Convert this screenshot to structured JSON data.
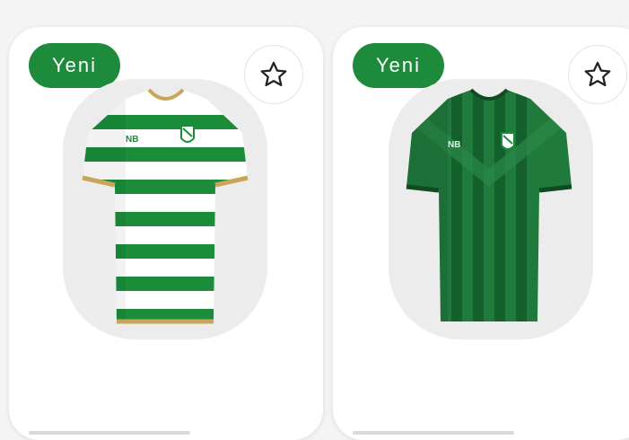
{
  "products": [
    {
      "badge_label": "Yeni",
      "favorite_icon": "star-outline-icon",
      "image": "white-green-striped-jersey",
      "colors": {
        "primary": "#1d8a3c",
        "secondary": "#ffffff",
        "trim": "#c9a55a"
      }
    },
    {
      "badge_label": "Yeni",
      "favorite_icon": "star-outline-icon",
      "image": "green-jersey",
      "colors": {
        "primary": "#1c6e36",
        "secondary": "#135a2a",
        "trim": "#0f4a22"
      }
    }
  ],
  "colors": {
    "badge": "#1d8a3c",
    "card": "#ffffff",
    "background": "#f3f4f3"
  }
}
